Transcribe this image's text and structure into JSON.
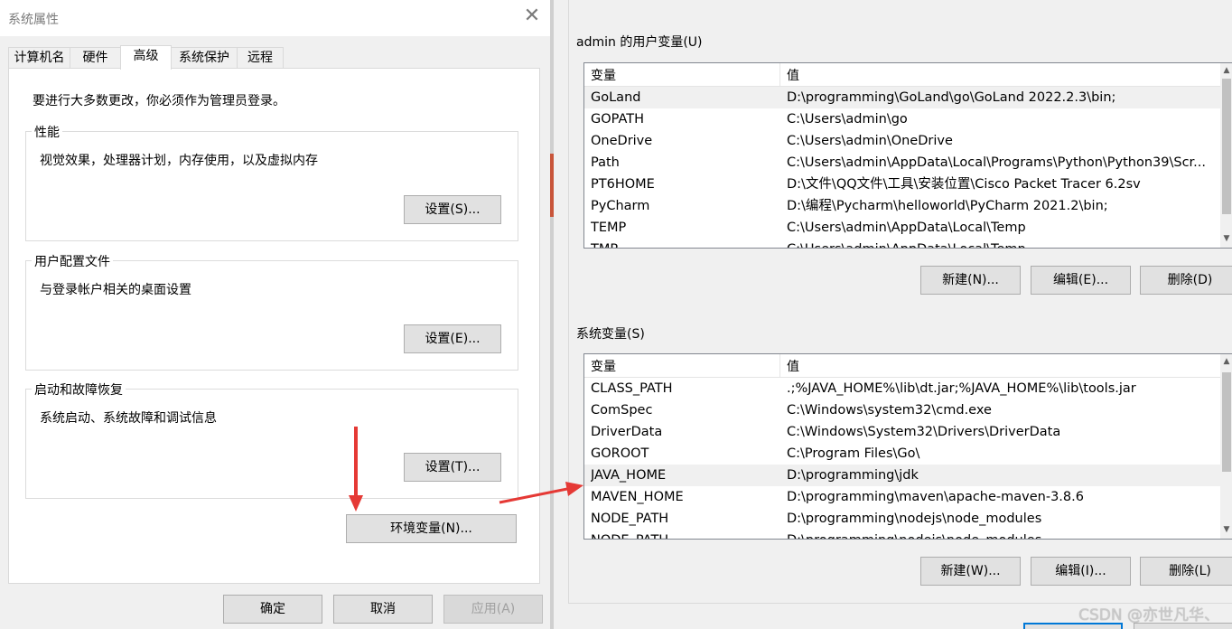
{
  "system_properties": {
    "title": "系统属性",
    "close_glyph": "✕",
    "tabs": [
      {
        "label": "计算机名"
      },
      {
        "label": "硬件"
      },
      {
        "label": "高级"
      },
      {
        "label": "系统保护"
      },
      {
        "label": "远程"
      }
    ],
    "active_tab": "高级",
    "admin_note": "要进行大多数更改，你必须作为管理员登录。",
    "groups": {
      "performance": {
        "label": "性能",
        "description": "视觉效果，处理器计划，内存使用，以及虚拟内存",
        "button": "设置(S)..."
      },
      "user_profiles": {
        "label": "用户配置文件",
        "description": "与登录帐户相关的桌面设置",
        "button": "设置(E)..."
      },
      "startup_recovery": {
        "label": "启动和故障恢复",
        "description": "系统启动、系统故障和调试信息",
        "button": "设置(T)..."
      }
    },
    "env_button": "环境变量(N)...",
    "footer": {
      "ok": "确定",
      "cancel": "取消",
      "apply": "应用(A)"
    }
  },
  "environment_variables": {
    "user_section_label": "admin 的用户变量(U)",
    "user_columns": {
      "name": "变量",
      "value": "值"
    },
    "user_rows": [
      {
        "name": "GoLand",
        "value": "D:\\programming\\GoLand\\go\\GoLand 2022.2.3\\bin;"
      },
      {
        "name": "GOPATH",
        "value": "C:\\Users\\admin\\go"
      },
      {
        "name": "OneDrive",
        "value": "C:\\Users\\admin\\OneDrive"
      },
      {
        "name": "Path",
        "value": "C:\\Users\\admin\\AppData\\Local\\Programs\\Python\\Python39\\Scr..."
      },
      {
        "name": "PT6HOME",
        "value": "D:\\文件\\QQ文件\\工具\\安装位置\\Cisco Packet Tracer 6.2sv"
      },
      {
        "name": "PyCharm",
        "value": "D:\\编程\\Pycharm\\helloworld\\PyCharm 2021.2\\bin;"
      },
      {
        "name": "TEMP",
        "value": "C:\\Users\\admin\\AppData\\Local\\Temp"
      },
      {
        "name": "TMP",
        "value": "C:\\Users\\admin\\AppData\\Local\\Temp"
      }
    ],
    "user_selected_row": 0,
    "user_buttons": {
      "new": "新建(N)...",
      "edit": "编辑(E)...",
      "delete": "删除(D)"
    },
    "system_section_label": "系统变量(S)",
    "system_columns": {
      "name": "变量",
      "value": "值"
    },
    "system_rows": [
      {
        "name": "CLASS_PATH",
        "value": ".;%JAVA_HOME%\\lib\\dt.jar;%JAVA_HOME%\\lib\\tools.jar"
      },
      {
        "name": "ComSpec",
        "value": "C:\\Windows\\system32\\cmd.exe"
      },
      {
        "name": "DriverData",
        "value": "C:\\Windows\\System32\\Drivers\\DriverData"
      },
      {
        "name": "GOROOT",
        "value": "C:\\Program Files\\Go\\"
      },
      {
        "name": "JAVA_HOME",
        "value": "D:\\programming\\jdk"
      },
      {
        "name": "MAVEN_HOME",
        "value": "D:\\programming\\maven\\apache-maven-3.8.6"
      },
      {
        "name": "NODE_PATH",
        "value": "D:\\programming\\nodejs\\node_modules"
      },
      {
        "name": "NODE_PATH",
        "value": "D:\\programming\\nodejs\\node_modules"
      }
    ],
    "system_selected_row": 4,
    "system_buttons": {
      "new": "新建(W)...",
      "edit": "编辑(I)...",
      "delete": "删除(L)"
    },
    "scroll_up_glyph": "▲",
    "scroll_down_glyph": "▼"
  },
  "watermark": "CSDN @亦世凡华、",
  "colors": {
    "arrow": "#e53935",
    "selection": "#f0f0f0",
    "accent_button_border": "#0078d7"
  }
}
